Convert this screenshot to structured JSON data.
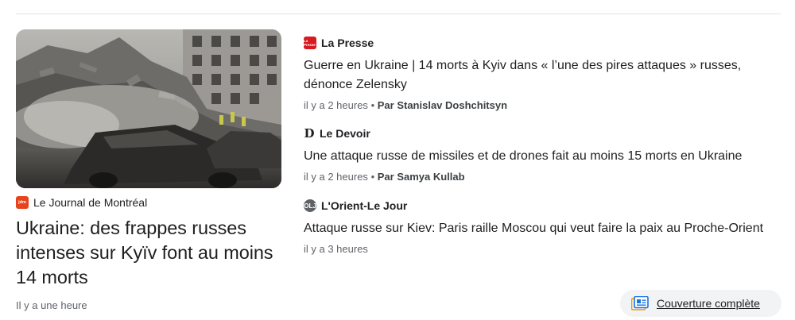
{
  "lead": {
    "source": "Le Journal de Montréal",
    "source_logo": "jdm",
    "title": "Ukraine: des frappes russes intenses sur Kyïv font au moins 14 morts",
    "time": "Il y a une heure"
  },
  "stories": [
    {
      "source": "La Presse",
      "source_logo": "La Presse",
      "title": "Guerre en Ukraine | 14 morts à Kyiv dans « l’une des pires attaques » russes, dénonce Zelensky",
      "time": "il y a 2 heures",
      "author": "Par Stanislav Doshchitsyn"
    },
    {
      "source": "Le Devoir",
      "source_logo": "D",
      "title": "Une attaque russe de missiles et de drones fait au moins 15 morts en Ukraine",
      "time": "il y a 2 heures",
      "author": "Par Samya Kullab"
    },
    {
      "source": "L'Orient-Le Jour",
      "source_logo": "OLJ",
      "title": "Attaque russe sur Kiev: Paris raille Moscou qui veut faire la paix au Proche-Orient",
      "time": "il y a 3 heures"
    }
  ],
  "full_coverage": {
    "label": "Couverture complète",
    "icon": "full-coverage-icon"
  },
  "colors": {
    "title": "#1f1f1f",
    "meta": "#5f6368",
    "pill_bg": "#f1f3f4",
    "jdm": "#e8441c",
    "la_presse": "#d71920"
  }
}
